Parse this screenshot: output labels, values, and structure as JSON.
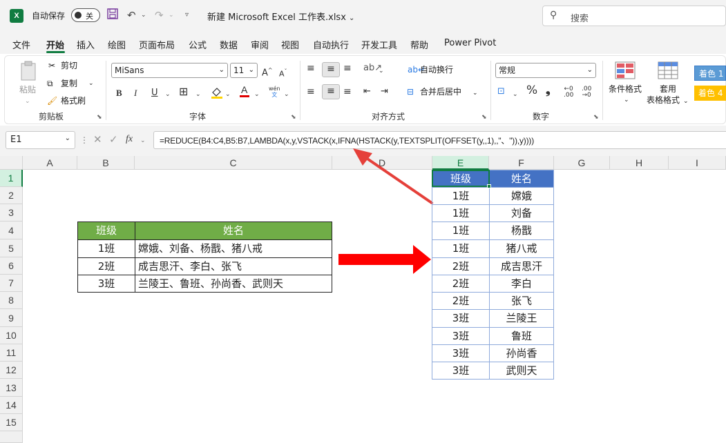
{
  "titlebar": {
    "autosave_label": "自动保存",
    "toggle_state": "关",
    "doc_title": "新建 Microsoft Excel 工作表.xlsx",
    "search_placeholder": "搜索"
  },
  "menu": [
    "文件",
    "开始",
    "插入",
    "绘图",
    "页面布局",
    "公式",
    "数据",
    "审阅",
    "视图",
    "自动执行",
    "开发工具",
    "帮助",
    "Power Pivot"
  ],
  "ribbon": {
    "clipboard": {
      "paste": "粘贴",
      "cut": "剪切",
      "copy": "复制",
      "format_painter": "格式刷",
      "label": "剪贴板"
    },
    "font": {
      "name": "MiSans",
      "size": "11",
      "label": "字体",
      "grow": "A",
      "shrink": "A",
      "bold": "B",
      "italic": "I",
      "underline": "U",
      "wen": "wén"
    },
    "alignment": {
      "wrap": "自动换行",
      "merge": "合并后居中",
      "label": "对齐方式"
    },
    "number": {
      "format": "常规",
      "label": "数字",
      "percent": "%"
    },
    "styles": {
      "cond_format": "条件格式",
      "table_format_1": "套用",
      "table_format_2": "表格格式",
      "style1": "着色 1",
      "style2": "着色 4"
    }
  },
  "formula_bar": {
    "name_box": "E1",
    "fx": "fx",
    "formula": "=REDUCE(B4:C4,B5:B7,LAMBDA(x,y,VSTACK(x,IFNA(HSTACK(y,TEXTSPLIT(OFFSET(y,,1),,\"、\")),y))))"
  },
  "columns": [
    "A",
    "B",
    "C",
    "D",
    "E",
    "F",
    "G",
    "H",
    "I"
  ],
  "rows": [
    "1",
    "2",
    "3",
    "4",
    "5",
    "6",
    "7",
    "8",
    "9",
    "10",
    "11",
    "12",
    "13",
    "14",
    "15"
  ],
  "source_table": {
    "headers": [
      "班级",
      "姓名"
    ],
    "rows": [
      [
        "1班",
        "嫦娥、刘备、杨戬、猪八戒"
      ],
      [
        "2班",
        "成吉思汗、李白、张飞"
      ],
      [
        "3班",
        "兰陵王、鲁班、孙尚香、武则天"
      ]
    ]
  },
  "result_table": {
    "headers": [
      "班级",
      "姓名"
    ],
    "rows": [
      [
        "1班",
        "嫦娥"
      ],
      [
        "1班",
        "刘备"
      ],
      [
        "1班",
        "杨戬"
      ],
      [
        "1班",
        "猪八戒"
      ],
      [
        "2班",
        "成吉思汗"
      ],
      [
        "2班",
        "李白"
      ],
      [
        "2班",
        "张飞"
      ],
      [
        "3班",
        "兰陵王"
      ],
      [
        "3班",
        "鲁班"
      ],
      [
        "3班",
        "孙尚香"
      ],
      [
        "3班",
        "武则天"
      ]
    ]
  },
  "colors": {
    "accent": "#107c41",
    "source_header": "#70ad47",
    "result_header": "#4472c4",
    "arrow": "#ff0000"
  }
}
